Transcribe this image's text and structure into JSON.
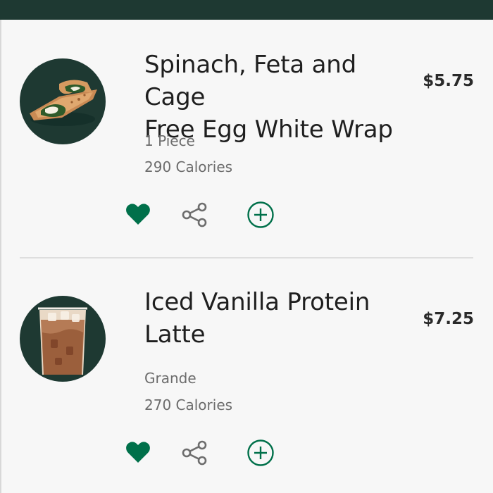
{
  "colors": {
    "brand": "#1e3932",
    "accent": "#00704a",
    "price": "#2a2a2a",
    "meta": "#6c6c6c"
  },
  "icons": {
    "favorite": "heart-icon",
    "share": "share-icon",
    "add": "add-circle-icon"
  },
  "menu": {
    "items": [
      {
        "title_line1": "Spinach, Feta and Cage",
        "title_line2": "Free Egg White Wrap",
        "price": "$5.75",
        "size": "1 Piece",
        "calories": "290 Calories",
        "image": "wrap-image"
      },
      {
        "title_line1": "Iced Vanilla Protein",
        "title_line2": "Latte",
        "price": "$7.25",
        "size": "Grande",
        "calories": "270 Calories",
        "image": "latte-image"
      }
    ]
  }
}
